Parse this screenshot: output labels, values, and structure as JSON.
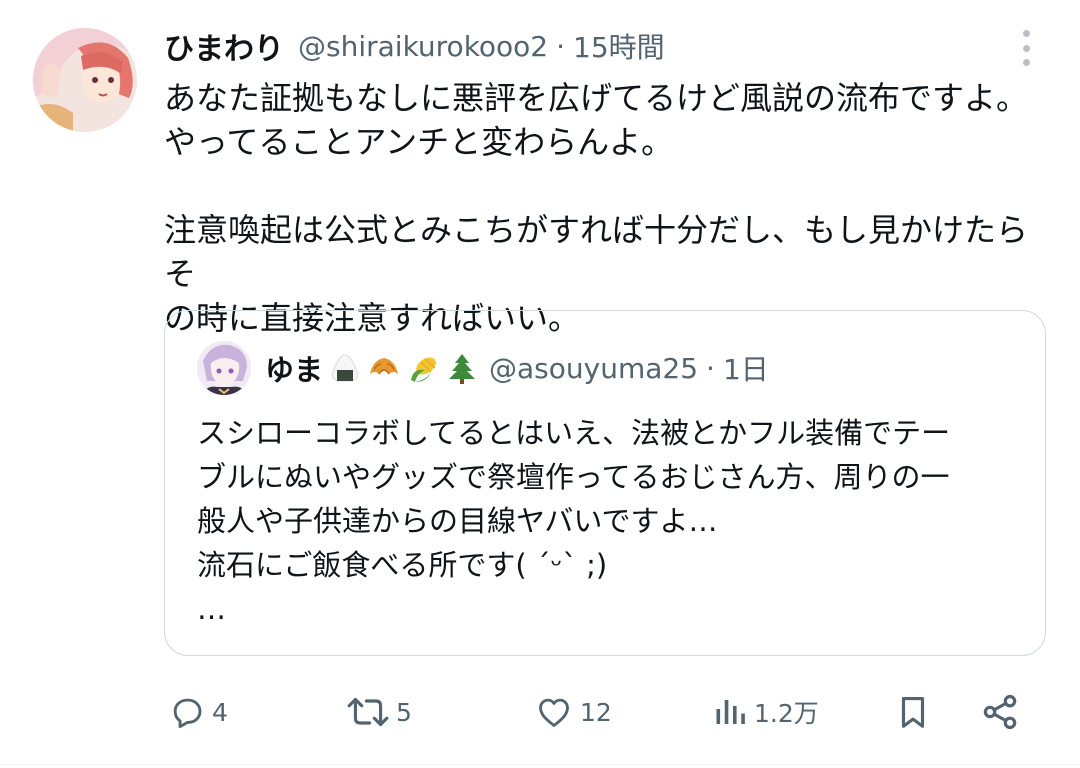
{
  "tweet": {
    "display_name": "ひまわり",
    "handle": "@shiraikurokooo2",
    "separator": "·",
    "time": "15時間",
    "lines": [
      "あなた証拠もなしに悪評を広げてるけど風説の流布ですよ。",
      "やってることアンチと変わらんよ。",
      "",
      "注意喚起は公式とみこちがすれば十分だし、もし見かけたらそ",
      "の時に直接注意すればいい。"
    ],
    "avatar_icon": "user-avatar-anime-girl"
  },
  "quote": {
    "display_name": "ゆま",
    "name_emojis": [
      "🍙",
      "🥐",
      "🌽",
      "🌲"
    ],
    "handle": "@asouyuma25",
    "separator": "·",
    "time": "1日",
    "lines": [
      "スシローコラボしてるとはいえ、法被とかフル装備でテー",
      "ブルにぬいやグッズで祭壇作ってるおじさん方、周りの一",
      "般人や子供達からの目線ヤバいですよ…",
      "流石にご飯食べる所です( ´ᵕ` ;)",
      "…"
    ]
  },
  "actions": {
    "reply_count": "4",
    "retweet_count": "5",
    "like_count": "12",
    "views_count": "1.2万",
    "icons": [
      "reply-icon",
      "retweet-icon",
      "like-icon",
      "views-icon",
      "bookmark-icon",
      "share-icon"
    ]
  },
  "colors": {
    "text": "#0f1419",
    "secondary": "#536471",
    "border": "#cfd9de"
  }
}
